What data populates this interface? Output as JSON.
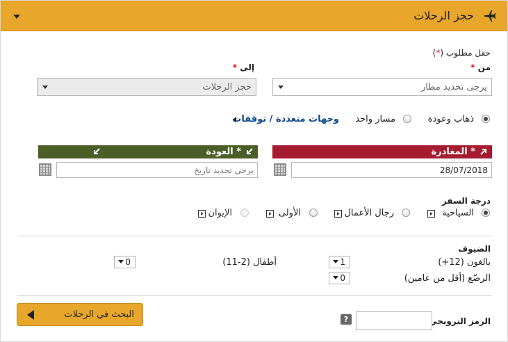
{
  "header": {
    "title": "حجز الرحلات"
  },
  "form": {
    "required_note": "حقل مطلوب",
    "required_paren_open": "(",
    "required_star": "*",
    "required_paren_close": ")",
    "from_label": "من",
    "to_label": "إلى",
    "from_value": "يرجى تحديد مطار",
    "to_value": "حجز الرحلات",
    "trip_types": {
      "roundtrip": "ذهاب وعودة",
      "oneway": "مسار واحد",
      "multicity": "وجهات متعددة / توقفات"
    },
    "selected_trip": "ذهاب وعودة",
    "departure": {
      "label": "المغادرة",
      "value": "28/07/2018"
    },
    "return": {
      "label": "العودة",
      "placeholder": "يرجى تحديد تاريخ"
    },
    "cabin": {
      "label": "درجة السفر",
      "options": [
        "السياحية",
        "رجال الأعمال",
        "الأولى",
        "الإيوان"
      ],
      "selected": "السياحية"
    },
    "guests": {
      "label": "الضيوف",
      "adults_label": "بالغون (12+)",
      "adults_value": "1",
      "children_label": "أطفال (2-11)",
      "children_value": "0",
      "infants_label": "الرضّع (أقل من عامين)",
      "infants_value": "0"
    },
    "promo": {
      "label": "الرمز الترويجي",
      "value": "",
      "help": "?"
    },
    "search_button": "البحث في الرحلات"
  },
  "colors": {
    "header_bg": "#e8a62a",
    "departure_bar": "#a51c30",
    "return_bar": "#4b5e28",
    "link": "#0f4a8a",
    "required": "#d2161b"
  }
}
